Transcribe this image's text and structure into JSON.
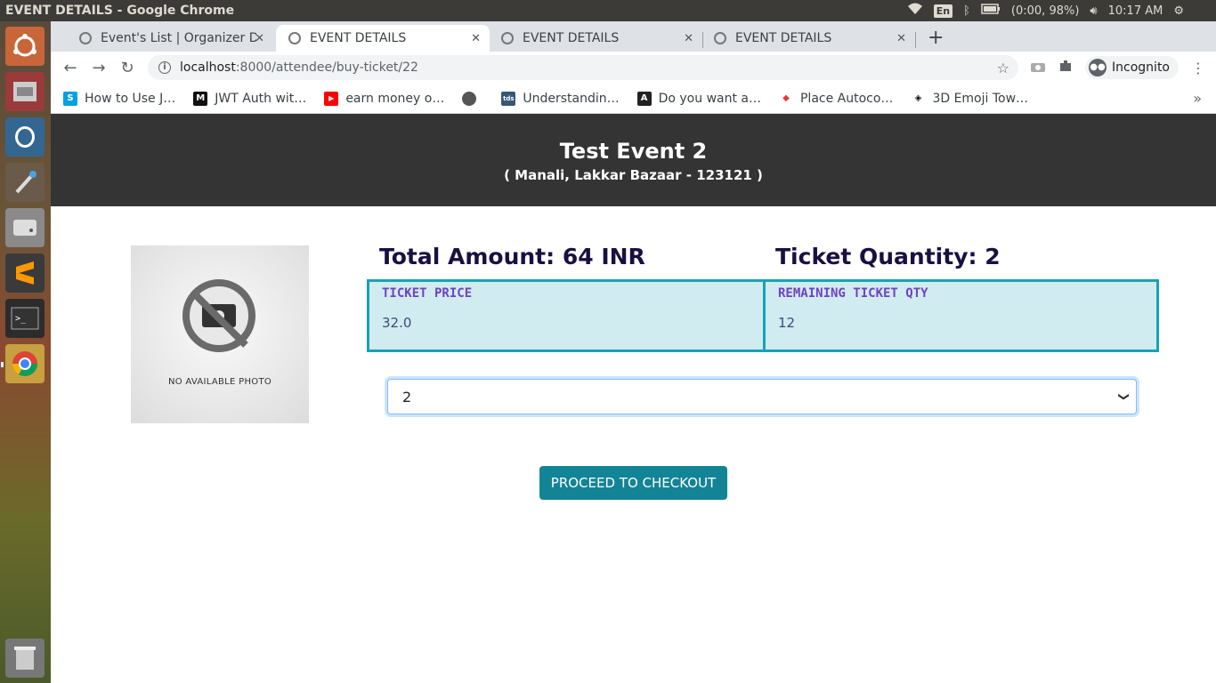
{
  "os": {
    "window_title": "EVENT DETAILS - Google Chrome",
    "keyboard": "En",
    "battery": "(0:00, 98%)",
    "clock": "10:17 AM"
  },
  "browser": {
    "tabs": [
      {
        "title": "Event's List | Organizer Da",
        "active": false
      },
      {
        "title": "EVENT DETAILS",
        "active": true
      },
      {
        "title": "EVENT DETAILS",
        "active": false
      },
      {
        "title": "EVENT DETAILS",
        "active": false
      }
    ],
    "url_host": "localhost",
    "url_path": ":8000/attendee/buy-ticket/22",
    "incognito_label": "Incognito",
    "bookmarks": [
      {
        "label": "How to Use J…",
        "icon": "S",
        "color": "#00a1e0"
      },
      {
        "label": "JWT Auth wit…",
        "icon": "M",
        "color": "#111111"
      },
      {
        "label": "earn money o…",
        "icon": "▶",
        "color": "#ff0000"
      },
      {
        "label": "",
        "icon": "globe",
        "color": "#555555"
      },
      {
        "label": "Understandin…",
        "icon": "tds",
        "color": "#355876"
      },
      {
        "label": "Do you want a…",
        "icon": "A",
        "color": "#222222"
      },
      {
        "label": "Place Autoco…",
        "icon": "◆",
        "color": "#e53935"
      },
      {
        "label": "3D Emoji Tow…",
        "icon": "◈",
        "color": "#111111"
      }
    ]
  },
  "event": {
    "title": "Test Event 2",
    "location": "( Manali, Lakkar Bazaar - 123121 )",
    "photo_caption": "NO AVAILABLE PHOTO",
    "total_amount": "Total Amount: 64 INR",
    "ticket_quantity": "Ticket Quantity: 2",
    "price_label": "TICKET PRICE",
    "price_value": "32.0",
    "remaining_label": "REMAINING TICKET QTY",
    "remaining_value": "12",
    "selected_qty": "2",
    "checkout_label": "PROCEED TO CHECKOUT"
  },
  "colors": {
    "hero_bg": "#343434",
    "info_border": "#17a2b8",
    "info_bg": "#d1ecf1",
    "button": "#138496"
  }
}
